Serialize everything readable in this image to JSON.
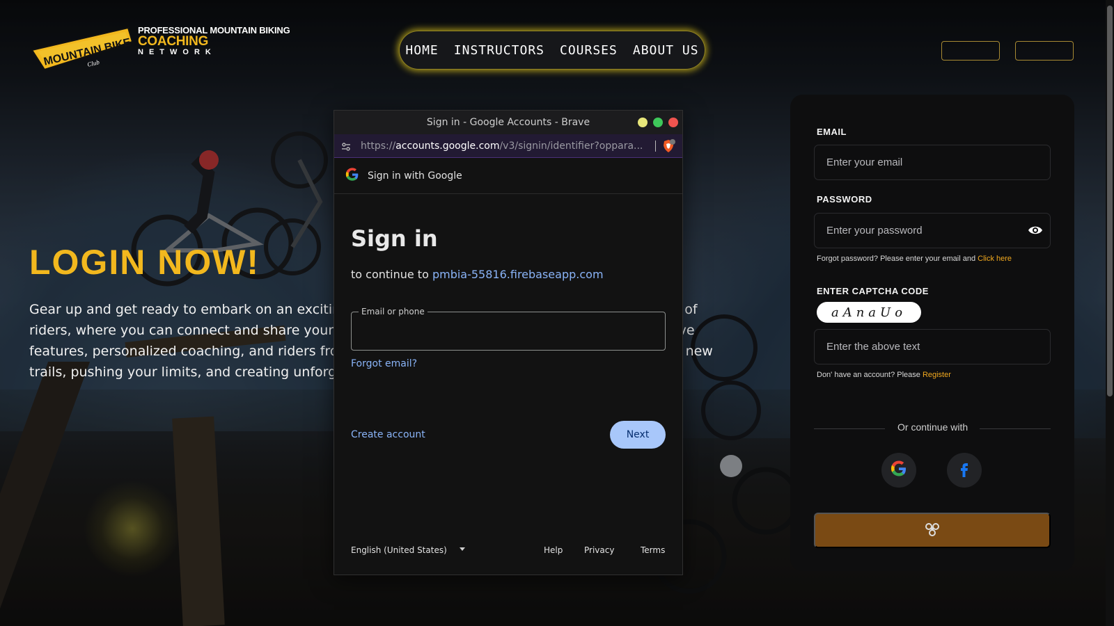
{
  "header": {
    "logo": {
      "badge_text": "MOUNTAIN BIKE",
      "badge_sub": "Club",
      "line1": "PROFESSIONAL MOUNTAIN BIKING",
      "line2": "COACHING",
      "line3": "NETWORK"
    },
    "nav": [
      "HOME",
      "INSTRUCTORS",
      "COURSES",
      "ABOUT US"
    ]
  },
  "hero": {
    "title": "LOGIN NOW!",
    "paragraph": "Gear up and get ready to embark on an exciting journey of adventure. Join our vibrant community of riders, where you can connect and share your love for this thrilling sport. Sign in to access exclusive features, personalized coaching, and riders from around the globe. Let's ride together and explore new trails, pushing your limits, and creating unforgettable memories."
  },
  "login": {
    "email_label": "EMAIL",
    "email_placeholder": "Enter your email",
    "password_label": "PASSWORD",
    "password_placeholder": "Enter your password",
    "forgot_text": "Forgot password? Please enter your email and ",
    "forgot_link": "Click here",
    "captcha_label": "ENTER CAPTCHA CODE",
    "captcha_code": "aAnaUo",
    "captcha_placeholder": "Enter the above text",
    "register_text": "Don' have an account? Please ",
    "register_link": "Register",
    "or_text": "Or continue with"
  },
  "popup": {
    "window_title": "Sign in - Google Accounts - Brave",
    "url_scheme": "https://",
    "url_host": "accounts.google.com",
    "url_path": "/v3/signin/identifier?oppara...",
    "gbar_text": "Sign in with Google",
    "heading": "Sign in",
    "continue_prefix": "to continue to ",
    "continue_domain": "pmbia-55816.firebaseapp.com",
    "email_label": "Email or phone",
    "forgot_email": "Forgot email?",
    "create_account": "Create account",
    "next": "Next",
    "language": "English (United States)",
    "help": "Help",
    "privacy": "Privacy",
    "terms": "Terms"
  },
  "colors": {
    "accent_yellow": "#f2b81e",
    "google_link": "#8ab4f8",
    "next_button": "#a8c7fa",
    "submit_button": "#7a4a14"
  }
}
